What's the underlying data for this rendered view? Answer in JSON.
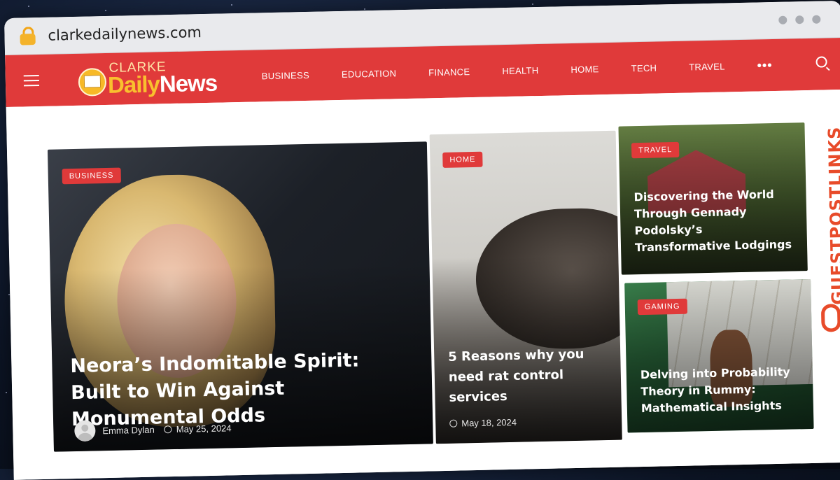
{
  "browser": {
    "url": "clarkedailynews.com"
  },
  "site": {
    "logo_top": "CLARKE",
    "logo_daily": "Daily",
    "logo_news": "News",
    "nav": [
      "BUSINESS",
      "EDUCATION",
      "FINANCE",
      "HEALTH",
      "HOME",
      "TECH",
      "TRAVEL"
    ],
    "more": "•••"
  },
  "articles": {
    "featured": {
      "category": "BUSINESS",
      "title": "Neora’s Indomitable Spirit: Built to Win Against Monumental Odds",
      "author": "Emma Dylan",
      "date": "May 25, 2024"
    },
    "middle": {
      "category": "HOME",
      "title": "5 Reasons why you need rat control services",
      "date": "May 18, 2024"
    },
    "top_right": {
      "category": "TRAVEL",
      "title": "Discovering the World Through Gennady Podolsky’s Transformative Lodgings"
    },
    "bottom_right": {
      "category": "GAMING",
      "title": "Delving into Probability Theory in Rummy: Mathematical Insights"
    }
  },
  "watermark": {
    "text": "GUESTPOSTLINKS"
  },
  "colors": {
    "brand_red": "#e03a3a",
    "logo_yellow": "#f9c02e",
    "watermark_orange": "#e84b2a"
  }
}
